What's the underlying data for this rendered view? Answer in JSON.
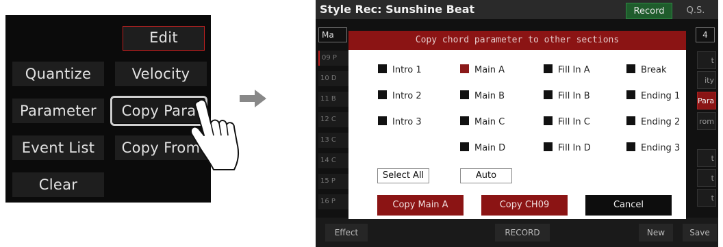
{
  "left_menu": {
    "edit": "Edit",
    "quantize": "Quantize",
    "velocity": "Velocity",
    "parameter": "Parameter",
    "copy_para": "Copy Para",
    "event_list": "Event List",
    "copy_from": "Copy From",
    "clear": "Clear"
  },
  "screen": {
    "title": "Style Rec: Sunshine Beat",
    "tab_record": "Record",
    "tab_qs": "Q.S.",
    "top_left": "Ma",
    "top_right": "4",
    "rows": [
      "09 P",
      "10 D",
      "11 B",
      "12 C",
      "13 C",
      "14 C",
      "15 P",
      "16 P"
    ],
    "right_buttons": [
      "t",
      "ity",
      "Para",
      "rom",
      "t",
      "t",
      "t"
    ],
    "bottom": {
      "effect": "Effect",
      "record": "RECORD",
      "new": "New",
      "save": "Save"
    }
  },
  "dialog": {
    "title": "Copy chord parameter to other sections",
    "options": [
      {
        "label": "Intro 1",
        "checked": false
      },
      {
        "label": "Main A",
        "checked": true
      },
      {
        "label": "Fill In A",
        "checked": false
      },
      {
        "label": "Break",
        "checked": false
      },
      {
        "label": "Intro 2",
        "checked": false
      },
      {
        "label": "Main B",
        "checked": false
      },
      {
        "label": "Fill In B",
        "checked": false
      },
      {
        "label": "Ending 1",
        "checked": false
      },
      {
        "label": "Intro 3",
        "checked": false
      },
      {
        "label": "Main C",
        "checked": false
      },
      {
        "label": "Fill In C",
        "checked": false
      },
      {
        "label": "Ending 2",
        "checked": false
      },
      {
        "label": "Main D",
        "checked": false
      },
      {
        "label": "Fill In D",
        "checked": false
      },
      {
        "label": "Ending 3",
        "checked": false
      }
    ],
    "select_all": "Select All",
    "auto": "Auto",
    "copy_main": "Copy Main A",
    "copy_ch": "Copy CH09",
    "cancel": "Cancel"
  },
  "colors": {
    "dialog_red": "#8b1414",
    "record_green": "#1f5c2c",
    "checked_box": "#8b1a1a"
  }
}
